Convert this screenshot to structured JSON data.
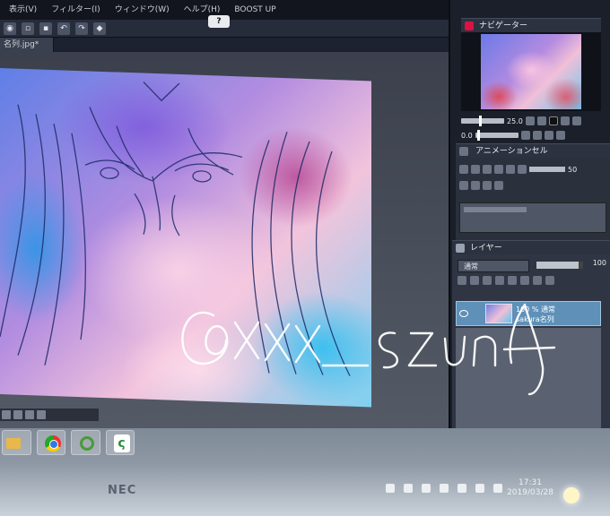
{
  "menubar": {
    "items": [
      "表示(V)",
      "フィルター(I)",
      "ウィンドウ(W)",
      "ヘルプ(H)",
      "BOOST UP"
    ]
  },
  "toolbar": {
    "help_badge": "?"
  },
  "document": {
    "tab_label": "名列.jpg*"
  },
  "navigator": {
    "title": "ナビゲーター",
    "zoom_value": "25.0",
    "rotate_value": "0.0"
  },
  "animation_cel": {
    "title": "アニメーションセル",
    "value": "50"
  },
  "layer_panel": {
    "title": "レイヤー",
    "blend_mode": "通常",
    "opacity": "100",
    "layer": {
      "line1": "100 % 通常",
      "line2": "sakura名列"
    }
  },
  "taskbar": {
    "brand": "NEC",
    "clock_time": "17:31",
    "clock_date": "2019/03/28",
    "apps": [
      "file-explorer-icon",
      "chrome-icon",
      "folder-icon",
      "clip-studio-icon"
    ]
  },
  "colors": {
    "accent_red": "#c6283a",
    "layer_selected": "#5e90b8"
  }
}
